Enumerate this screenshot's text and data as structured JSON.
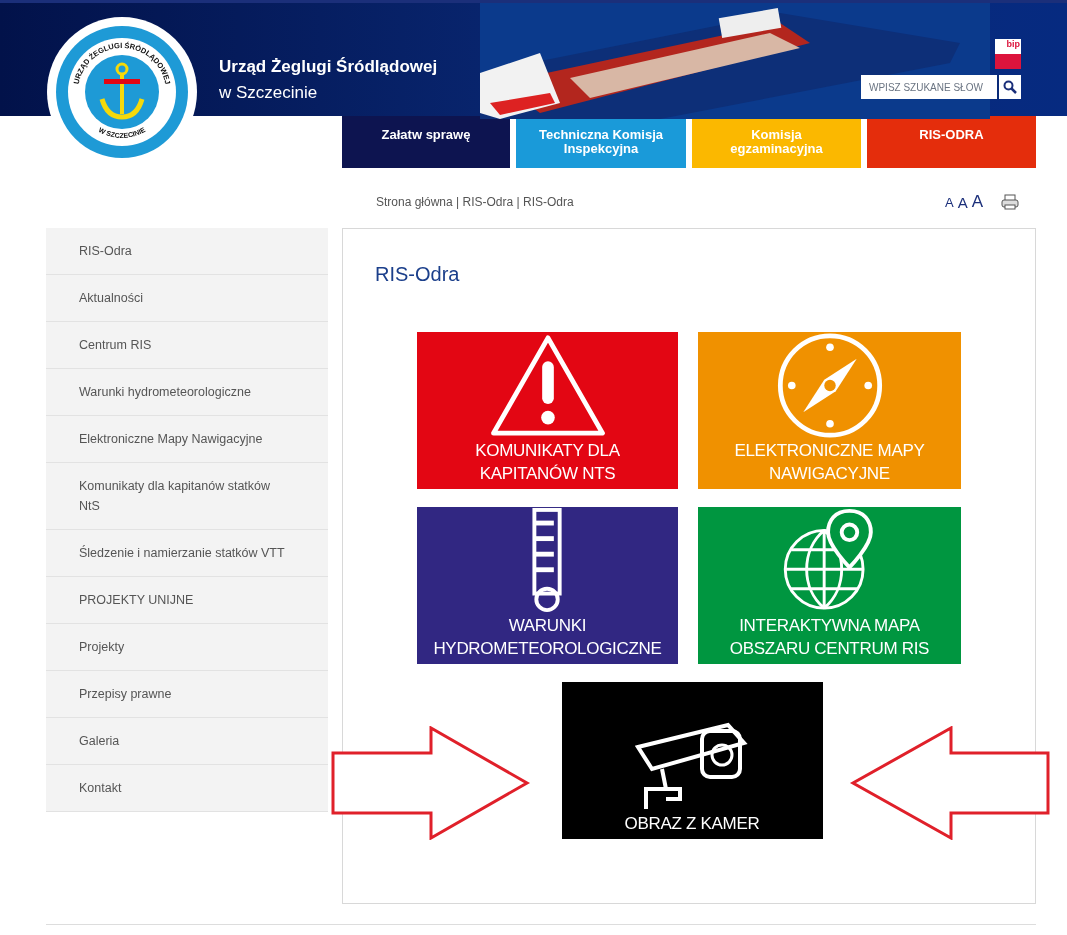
{
  "header": {
    "logo_ring_top": "URZĄD ŻEGLUGI ŚRÓDLĄDOWEJ",
    "logo_ring_bottom": "W SZCZECINIE",
    "title": "Urząd Żeglugi Śródlądowej",
    "subtitle": "w Szczecinie",
    "bip": "bip",
    "search": {
      "placeholder": "WPISZ SZUKANE SŁOW"
    }
  },
  "nav": [
    {
      "label": "Załatw sprawę",
      "color": "#0d1450"
    },
    {
      "label": "Techniczna Komisja Inspekcyjna",
      "color": "#1a9ad9"
    },
    {
      "label": "Komisja egzaminacyjna",
      "color": "#fbb800"
    },
    {
      "label": "RIS-ODRA",
      "color": "#e42d0c"
    }
  ],
  "breadcrumb": "Strona główna | RIS-Odra | RIS-Odra",
  "font_sizes": [
    "A",
    "A",
    "A"
  ],
  "sidebar": [
    {
      "label": "RIS-Odra"
    },
    {
      "label": "Aktualności"
    },
    {
      "label": "Centrum RIS"
    },
    {
      "label": "Warunki hydrometeorologiczne"
    },
    {
      "label": "Elektroniczne Mapy Nawigacyjne"
    },
    {
      "label": "Komunikaty dla kapitanów statków NtS"
    },
    {
      "label": "Śledzenie i namierzanie statków VTT"
    },
    {
      "label": "PROJEKTY UNIJNE"
    },
    {
      "label": "Projekty"
    },
    {
      "label": "Przepisy prawne"
    },
    {
      "label": "Galeria"
    },
    {
      "label": "Kontakt"
    }
  ],
  "content": {
    "title": "RIS-Odra",
    "tiles": [
      {
        "kind": "warning",
        "lines": [
          "KOMUNIKATY DLA",
          "KAPITANÓW NTS"
        ],
        "color": "#e30613"
      },
      {
        "kind": "compass",
        "lines": [
          "ELEKTRONICZNE MAPY",
          "NAWIGACYJNE"
        ],
        "color": "#f09100"
      },
      {
        "kind": "gauge",
        "lines": [
          "WARUNKI",
          "HYDROMETEOROLOGICZNE"
        ],
        "color": "#312782"
      },
      {
        "kind": "globe",
        "lines": [
          "INTERAKTYWNA MAPA",
          "OBSZARU CENTRUM RIS"
        ],
        "color": "#009640"
      },
      {
        "kind": "camera",
        "lines": [
          "OBRAZ Z KAMER"
        ],
        "color": "#000000"
      }
    ]
  }
}
